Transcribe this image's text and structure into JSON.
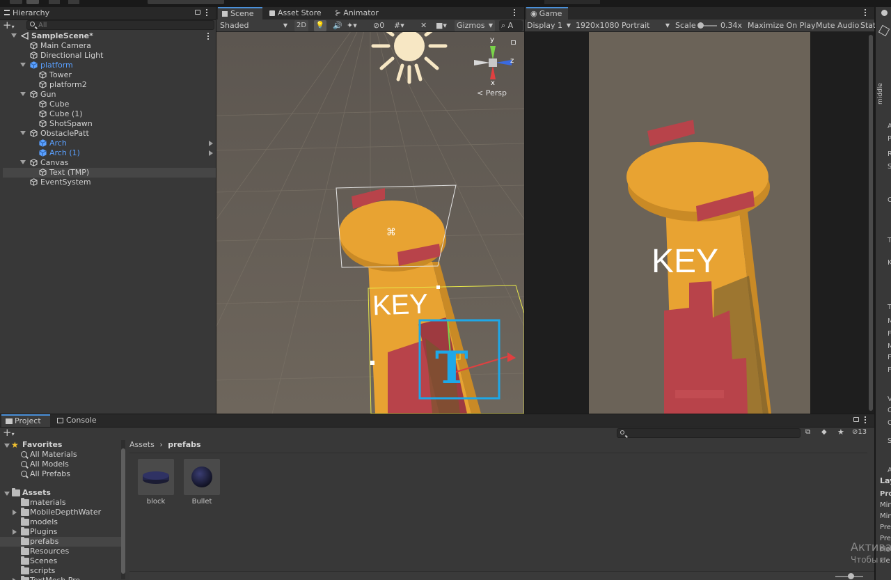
{
  "hierarchy": {
    "tab": "Hierarchy",
    "search_placeholder": "All",
    "items": [
      {
        "label": "SampleScene*",
        "depth": 0,
        "type": "scene",
        "expanded": true
      },
      {
        "label": "Main Camera",
        "depth": 1,
        "type": "obj"
      },
      {
        "label": "Directional Light",
        "depth": 1,
        "type": "obj"
      },
      {
        "label": "platform",
        "depth": 1,
        "type": "prefab",
        "expanded": true
      },
      {
        "label": "Tower",
        "depth": 2,
        "type": "obj-mod"
      },
      {
        "label": "platform2",
        "depth": 2,
        "type": "obj-mod"
      },
      {
        "label": "Gun",
        "depth": 1,
        "type": "obj",
        "expanded": true
      },
      {
        "label": "Cube",
        "depth": 2,
        "type": "obj"
      },
      {
        "label": "Cube (1)",
        "depth": 2,
        "type": "obj"
      },
      {
        "label": "ShotSpawn",
        "depth": 2,
        "type": "obj"
      },
      {
        "label": "ObstaclePatt",
        "depth": 1,
        "type": "obj",
        "expanded": true
      },
      {
        "label": "Arch",
        "depth": 2,
        "type": "prefab",
        "arrow": true
      },
      {
        "label": "Arch (1)",
        "depth": 2,
        "type": "prefab",
        "arrow": true
      },
      {
        "label": "Canvas",
        "depth": 1,
        "type": "obj",
        "expanded": true
      },
      {
        "label": "Text (TMP)",
        "depth": 2,
        "type": "obj",
        "selected": true
      },
      {
        "label": "EventSystem",
        "depth": 1,
        "type": "obj"
      }
    ]
  },
  "scene": {
    "tabs": [
      "Scene",
      "Asset Store",
      "Animator"
    ],
    "shading": "Shaded",
    "mode2d": "2D",
    "hidden_count": "0",
    "gizmos": "Gizmos",
    "search_letter": "A",
    "persp": "< Persp",
    "axis_y": "y",
    "axis_x": "x",
    "axis_z": "z",
    "text_label": "KEY"
  },
  "game": {
    "tab": "Game",
    "display": "Display 1",
    "resolution": "1920x1080 Portrait",
    "scale_label": "Scale",
    "scale_value": "0.34x",
    "maximize": "Maximize On Play",
    "mute": "Mute Audio",
    "stats": "Stat",
    "text_label": "KEY"
  },
  "project": {
    "tabs": [
      "Project",
      "Console"
    ],
    "hidden_count": "13",
    "breadcrumb": [
      "Assets",
      "prefabs"
    ],
    "favorites_label": "Favorites",
    "favorites": [
      "All Materials",
      "All Models",
      "All Prefabs"
    ],
    "assets_label": "Assets",
    "folders": [
      {
        "label": "materials",
        "arrow": false
      },
      {
        "label": "MobileDepthWater",
        "arrow": true
      },
      {
        "label": "models",
        "arrow": false
      },
      {
        "label": "Plugins",
        "arrow": true
      },
      {
        "label": "prefabs",
        "arrow": false,
        "selected": true
      },
      {
        "label": "Resources",
        "arrow": false
      },
      {
        "label": "Scenes",
        "arrow": false
      },
      {
        "label": "scripts",
        "arrow": false
      },
      {
        "label": "TextMesh Pro",
        "arrow": true
      }
    ],
    "assets": [
      {
        "label": "block",
        "shape": "disc"
      },
      {
        "label": "Bullet",
        "shape": "sphere"
      }
    ]
  },
  "inspector": {
    "vertical_label": "middle",
    "letters": [
      "A",
      "P",
      "R",
      "S",
      "C",
      "T",
      "K",
      "T",
      "M",
      "F",
      "M",
      "F",
      "F",
      "V",
      "C",
      "C",
      "S",
      "A"
    ],
    "layout_label": "Lay",
    "bottom_rows": [
      "Pro",
      "Min",
      "Min",
      "Pre",
      "Pre",
      "Fle",
      "Fle"
    ]
  },
  "watermark": {
    "line1": "Активац",
    "line2": "Чтобы а"
  },
  "colors": {
    "accent": "#4a90d9",
    "prefab_blue": "#5aa0ff",
    "tower_orange": "#e8a332",
    "wall_red": "#b8434a",
    "ground": "#6b6358"
  }
}
